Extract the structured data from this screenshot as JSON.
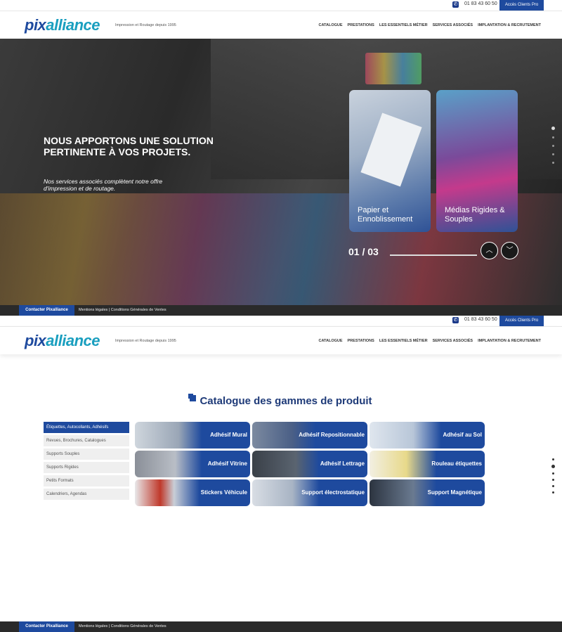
{
  "top_bar": {
    "phone": "01 83 43 60 50",
    "pro_button": "Accès Clients Pro"
  },
  "header": {
    "logo_main": "pix",
    "logo_accent": "alliance",
    "tagline": "Impression et Routage depuis 1995",
    "nav": [
      "CATALOGUE",
      "PRESTATIONS",
      "LES ESSENTIELS MÉTIER",
      "SERVICES ASSOCIÉS",
      "IMPLANTATION & RECRUTEMENT"
    ]
  },
  "hero": {
    "title": "NOUS APPORTONS UNE SOLUTION PERTINENTE À VOS PROJETS.",
    "subtitle": "Nos services associés complètent notre offre d'impression et de routage.",
    "cards": [
      {
        "label": "Papier et Ennoblissement"
      },
      {
        "label": "Médias Rigides & Souples"
      }
    ],
    "counter": "01 / 03",
    "prev_icon": "chevron-up-icon",
    "next_icon": "chevron-down-icon"
  },
  "footer_bar": {
    "contact": "Contacter Pixalliance",
    "legal": "Mentions légales | Conditions Générales de Ventes"
  },
  "catalogue": {
    "title": "Catalogue des gammes de produit",
    "menu": [
      "Étiquettes, Autocollants, Adhésifs",
      "Revues, Brochures, Catalogues",
      "Supports Souples",
      "Supports Rigides",
      "Petits Formats",
      "Calendriers, Agendas"
    ],
    "active_menu_index": 0,
    "tiles": [
      "Adhésif Mural",
      "Adhésif Repositionnable",
      "Adhésif au Sol",
      "Adhésif Vitrine",
      "Adhésif Lettrage",
      "Rouleau étiquettes",
      "Stickers Véhicule",
      "Support électrostatique",
      "Support Magnétique"
    ]
  },
  "colors": {
    "brand_blue": "#1e4a9e",
    "accent_cyan": "#1a9fbf",
    "dark_bar": "#2a2a2a"
  }
}
